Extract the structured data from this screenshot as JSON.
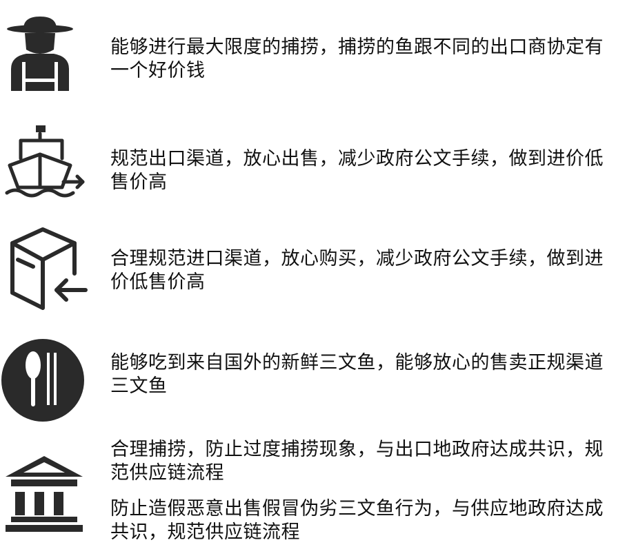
{
  "rows": [
    {
      "icon": "farmer-icon",
      "text": "能够进行最大限度的捕捞，捕捞的鱼跟不同的出口商协定有一个好价钱"
    },
    {
      "icon": "ship-export-icon",
      "text": "规范出口渠道，放心出售，减少政府公文手续，做到进价低售价高"
    },
    {
      "icon": "box-import-icon",
      "text": "合理规范进口渠道，放心购买，减少政府公文手续，做到进价低售价高"
    },
    {
      "icon": "dining-utensils-icon",
      "text": "能够吃到来自国外的新鲜三文鱼，能够放心的售卖正规渠道三文鱼"
    },
    {
      "icon": "government-building-icon",
      "text": "合理捕捞，防止过度捕捞现象，与出口地政府达成共识，规范供应链流程",
      "text2": "防止造假恶意出售假冒伪劣三文鱼行为，与供应地政府达成共识，规范供应链流程"
    }
  ],
  "colors": {
    "icon": "#2a2a2a",
    "text": "#111111"
  }
}
